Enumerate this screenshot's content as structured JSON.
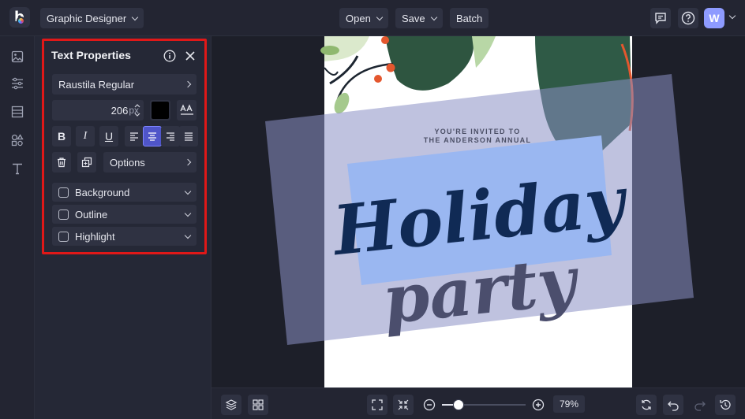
{
  "header": {
    "app_mode": "Graphic Designer",
    "open_label": "Open",
    "save_label": "Save",
    "batch_label": "Batch",
    "avatar_letter": "W"
  },
  "panel": {
    "title": "Text Properties",
    "font_name": "Raustila Regular",
    "font_size": "206",
    "font_size_unit": "px",
    "color": "#000000",
    "bold_label": "B",
    "italic_label": "I",
    "underline_label": "U",
    "options_label": "Options",
    "accordions": [
      "Background",
      "Outline",
      "Highlight"
    ]
  },
  "canvas": {
    "invite_line1": "YOU'RE INVITED TO",
    "invite_line2": "THE ANDERSON ANNUAL",
    "headline": "Holiday",
    "subline": "party"
  },
  "footer": {
    "zoom": "79%"
  },
  "colors": {
    "accent": "#4f55c9",
    "highlight_border": "#e01818"
  }
}
